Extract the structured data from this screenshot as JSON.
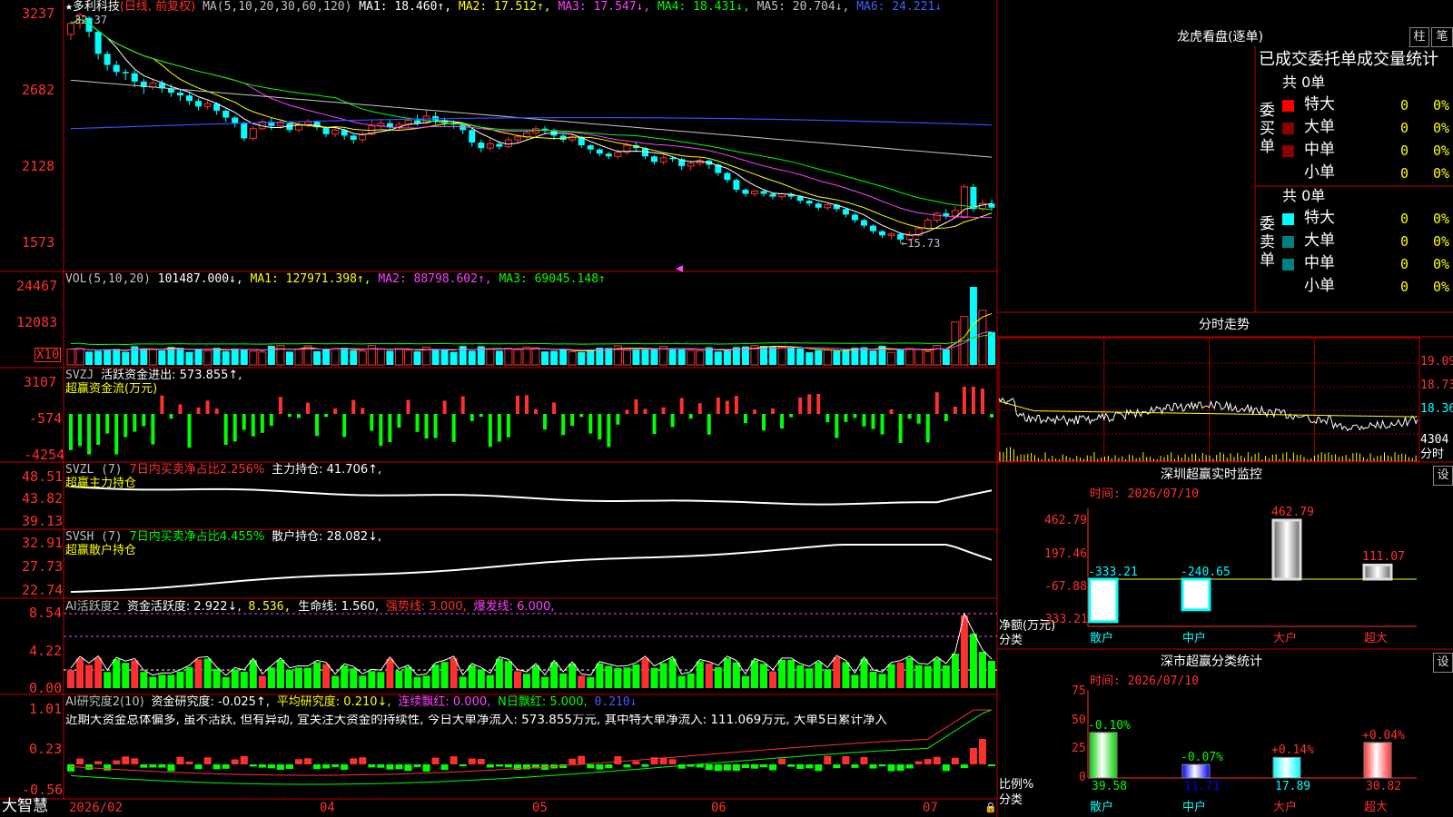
{
  "header": {
    "star": "★",
    "name": "多利科技",
    "mode": "(日线, 前复权)",
    "ma_param": "MA(5,10,20,30,60,120)",
    "ma1": "MA1: 18.460↑,",
    "ma2": "MA2: 17.512↑,",
    "ma3": "MA3: 17.547↓,",
    "ma4": "MA4: 18.431↓,",
    "ma5": "MA5: 20.704↓,",
    "ma6": "MA6: 24.221↓"
  },
  "price_panel": {
    "y_ticks": [
      "3237",
      "2682",
      "2128",
      "1573"
    ],
    "high_label": "32.37",
    "low_label": "←15.73"
  },
  "vol_panel": {
    "title": "VOL(5,10,20)",
    "v": "101487.000↓,",
    "ma1": "MA1: 127971.398↑,",
    "ma2": "MA2: 88798.602↑,",
    "ma3": "MA3: 69045.148↑",
    "y_ticks": [
      "24467",
      "12083"
    ],
    "unit": "X10"
  },
  "svzj_panel": {
    "title": "SVZJ",
    "line": "活跃资金进出: 573.855↑,",
    "sub": "超赢资金流(万元)",
    "y_ticks": [
      "3107",
      "-574",
      "-4254"
    ]
  },
  "svzl_panel": {
    "title": "SVZL (7)",
    "ratio": "7日内买卖净占比2.256%",
    "hold": "主力持仓: 41.706↑,",
    "sub": "超赢主力持仓",
    "y_ticks": [
      "48.51",
      "43.82",
      "39.13"
    ]
  },
  "svsh_panel": {
    "title": "SVSH (7)",
    "ratio": "7日内买卖净占比4.455%",
    "hold": "散户持仓: 28.082↓,",
    "sub": "超赢散户持仓",
    "y_ticks": [
      "32.91",
      "27.73",
      "22.74"
    ]
  },
  "ai1_panel": {
    "title": "AI活跃度2",
    "a": "资金活跃度: 2.922↓,",
    "b": "8.536,",
    "c": "生命线: 1.560,",
    "d": "强势线: 3.000,",
    "e": "爆发线: 6.000,",
    "y_ticks": [
      "8.54",
      "4.22",
      "0.00"
    ]
  },
  "ai2_panel": {
    "title": "AI研究度2(10)",
    "a": "资金研究度: -0.025↑,",
    "b": "平均研究度: 0.210↓,",
    "c": "连续飘红: 0.000,",
    "d": "N日飘红: 5.000,",
    "e": "0.210↓",
    "comment": "近期大资金总体偏多, 虽不活跃, 但有异动, 宜关注大资金的持续性, 今日大单净流入: 573.855万元, 其中特大单净流入: 111.069万元, 大单5日累计净入",
    "y_ticks": [
      "1.01",
      "0.23",
      "-0.56"
    ]
  },
  "bottom_bar": {
    "brand": "大智慧",
    "dates": [
      "2026/02",
      "04",
      "05",
      "06",
      "07"
    ]
  },
  "lhb": {
    "title": "龙虎看盘(逐单)",
    "btn1": "柱",
    "btn2": "笔",
    "subtitle": "已成交委托单成交量统计",
    "buy_label": "委买单",
    "sell_label": "委卖单",
    "buy_total": "共 0单",
    "sell_total": "共 0单",
    "rows": [
      {
        "name": "特大",
        "v": "0",
        "p": "0%"
      },
      {
        "name": "大单",
        "v": "0",
        "p": "0%"
      },
      {
        "name": "中单",
        "v": "0",
        "p": "0%"
      },
      {
        "name": "小单",
        "v": "0",
        "p": "0%"
      }
    ],
    "buy_colors": [
      "#ff0000",
      "#8b0000",
      "#8b0000",
      "#000000"
    ],
    "sell_colors": [
      "#00ffff",
      "#008080",
      "#008080",
      "#000000"
    ]
  },
  "fenshi": {
    "title": "分时走势",
    "prices": [
      "19.09",
      "18.73",
      "18.36"
    ],
    "vol_label": "4304",
    "unit": "分时"
  },
  "sz_monitor": {
    "title": "深圳超赢实时监控",
    "btn": "设",
    "time": "时间: 2026/07/10",
    "y_ticks": [
      "462.79",
      "197.46",
      "-67.88",
      "-333.21"
    ],
    "ylabel1": "净额(万元)",
    "ylabel2": "分类"
  },
  "sz_class": {
    "title": "深市超赢分类统计",
    "btn": "设",
    "time": "时间: 2026/07/10",
    "y_ticks": [
      "75",
      "50",
      "25",
      "0"
    ],
    "ylabel1": "比例%",
    "ylabel2": "分类"
  },
  "chart_data": [
    {
      "type": "bar",
      "title": "深圳超赢实时监控",
      "categories": [
        "散户",
        "中户",
        "大户",
        "超大"
      ],
      "values": [
        -333.21,
        -240.65,
        462.79,
        111.07
      ],
      "value_labels": [
        "-333.21",
        "-240.65",
        "462.79",
        "111.07"
      ],
      "ylim": [
        -333.21,
        462.79
      ]
    },
    {
      "type": "bar",
      "title": "深市超赢分类统计",
      "categories": [
        "散户",
        "中户",
        "大户",
        "超大"
      ],
      "values": [
        39.58,
        11.71,
        17.89,
        30.82
      ],
      "changes": [
        "-0.10%",
        "-0.07%",
        "+0.14%",
        "+0.04%"
      ],
      "ylim": [
        0,
        75
      ]
    },
    {
      "type": "line",
      "title": "price",
      "ylim": [
        15.73,
        32.37
      ],
      "candles": [
        [
          30.8,
          31.6,
          31.8,
          30.4
        ],
        [
          31.6,
          32.2,
          32.37,
          31.2
        ],
        [
          32.0,
          31.0,
          32.1,
          30.6
        ],
        [
          31.0,
          29.4,
          31.1,
          29.0
        ],
        [
          29.4,
          28.6,
          29.6,
          28.2
        ],
        [
          28.6,
          28.1,
          28.9,
          27.8
        ],
        [
          28.1,
          28.0,
          28.3,
          27.5
        ],
        [
          28.0,
          27.4,
          28.2,
          27.0
        ],
        [
          27.4,
          27.0,
          27.6,
          26.5
        ],
        [
          27.0,
          27.3,
          27.6,
          26.8
        ],
        [
          27.3,
          26.9,
          27.5,
          26.6
        ],
        [
          26.9,
          26.6,
          27.2,
          26.3
        ],
        [
          26.6,
          26.4,
          26.8,
          26.0
        ],
        [
          26.4,
          26.0,
          26.6,
          25.7
        ],
        [
          26.0,
          25.6,
          26.2,
          25.3
        ],
        [
          25.6,
          25.8,
          26.0,
          25.4
        ],
        [
          25.8,
          25.3,
          25.9,
          25.0
        ],
        [
          25.3,
          24.8,
          25.4,
          24.5
        ],
        [
          24.8,
          24.4,
          24.9,
          24.1
        ],
        [
          24.4,
          23.3,
          24.5,
          23.1
        ],
        [
          23.3,
          24.0,
          24.2,
          23.1
        ],
        [
          24.0,
          24.5,
          24.7,
          23.9
        ],
        [
          24.5,
          24.2,
          24.8,
          23.9
        ],
        [
          24.2,
          24.4,
          24.6,
          24.0
        ],
        [
          24.4,
          23.9,
          24.5,
          23.7
        ],
        [
          23.9,
          24.3,
          24.5,
          23.7
        ],
        [
          24.3,
          24.5,
          24.7,
          24.1
        ],
        [
          24.5,
          24.1,
          24.6,
          23.9
        ],
        [
          24.1,
          23.6,
          24.2,
          23.4
        ],
        [
          23.6,
          23.9,
          24.1,
          23.4
        ],
        [
          23.9,
          23.5,
          24.0,
          23.2
        ],
        [
          23.5,
          23.2,
          23.6,
          22.9
        ],
        [
          23.2,
          23.6,
          23.8,
          23.0
        ],
        [
          23.6,
          24.2,
          24.6,
          23.5
        ],
        [
          24.2,
          24.4,
          24.7,
          24.0
        ],
        [
          24.4,
          24.1,
          24.6,
          23.8
        ],
        [
          24.1,
          24.3,
          24.5,
          23.9
        ],
        [
          24.3,
          24.6,
          24.8,
          24.1
        ],
        [
          24.6,
          24.4,
          25.0,
          24.2
        ],
        [
          24.4,
          24.9,
          25.4,
          24.3
        ],
        [
          24.9,
          24.6,
          25.2,
          24.3
        ],
        [
          24.6,
          24.4,
          24.8,
          24.1
        ],
        [
          24.4,
          24.3,
          24.6,
          24.0
        ],
        [
          24.3,
          23.9,
          24.4,
          23.6
        ],
        [
          23.9,
          23.0,
          24.0,
          22.7
        ],
        [
          23.0,
          22.6,
          23.2,
          22.3
        ],
        [
          22.6,
          22.9,
          23.3,
          22.4
        ],
        [
          22.9,
          22.7,
          23.1,
          22.5
        ],
        [
          22.7,
          23.2,
          23.4,
          22.6
        ],
        [
          23.2,
          23.4,
          23.6,
          23.0
        ],
        [
          23.4,
          23.7,
          23.9,
          23.2
        ],
        [
          23.7,
          24.0,
          24.2,
          23.5
        ],
        [
          24.0,
          23.9,
          24.2,
          23.6
        ],
        [
          23.9,
          23.5,
          24.0,
          23.2
        ],
        [
          23.5,
          23.2,
          23.6,
          23.0
        ],
        [
          23.2,
          23.4,
          23.6,
          23.0
        ],
        [
          23.4,
          22.8,
          23.5,
          22.6
        ],
        [
          22.8,
          22.5,
          22.9,
          22.2
        ],
        [
          22.5,
          22.2,
          22.6,
          22.0
        ],
        [
          22.2,
          22.0,
          22.3,
          21.8
        ],
        [
          22.0,
          22.3,
          22.5,
          21.8
        ],
        [
          22.3,
          22.8,
          23.0,
          22.1
        ],
        [
          22.8,
          22.6,
          23.0,
          22.3
        ],
        [
          22.6,
          22.0,
          22.7,
          21.8
        ],
        [
          22.0,
          21.6,
          22.1,
          21.4
        ],
        [
          21.6,
          21.9,
          22.1,
          21.4
        ],
        [
          21.9,
          21.8,
          22.0,
          21.6
        ],
        [
          21.8,
          21.3,
          21.9,
          21.0
        ],
        [
          21.3,
          21.5,
          21.7,
          21.0
        ],
        [
          21.5,
          21.7,
          21.9,
          21.3
        ],
        [
          21.7,
          21.4,
          21.8,
          21.1
        ],
        [
          21.4,
          20.8,
          21.5,
          20.6
        ],
        [
          20.8,
          20.3,
          20.9,
          20.1
        ],
        [
          20.3,
          19.6,
          20.4,
          19.4
        ],
        [
          19.6,
          19.3,
          19.7,
          19.1
        ],
        [
          19.3,
          19.5,
          19.6,
          19.1
        ],
        [
          19.5,
          19.3,
          19.6,
          19.1
        ],
        [
          19.3,
          19.1,
          19.4,
          18.9
        ],
        [
          19.1,
          19.3,
          19.4,
          18.9
        ],
        [
          19.3,
          19.1,
          19.4,
          18.9
        ],
        [
          19.1,
          18.8,
          19.2,
          18.6
        ],
        [
          18.8,
          18.6,
          18.9,
          18.4
        ],
        [
          18.6,
          18.3,
          18.7,
          18.1
        ],
        [
          18.3,
          18.5,
          18.6,
          18.1
        ],
        [
          18.5,
          18.2,
          18.6,
          18.0
        ],
        [
          18.2,
          17.8,
          18.3,
          17.6
        ],
        [
          17.8,
          17.4,
          17.9,
          17.2
        ],
        [
          17.4,
          17.0,
          17.5,
          16.8
        ],
        [
          17.0,
          16.6,
          17.1,
          16.4
        ],
        [
          16.6,
          16.3,
          16.7,
          16.1
        ],
        [
          16.3,
          16.4,
          16.5,
          16.0
        ],
        [
          16.4,
          16.0,
          16.5,
          15.73
        ],
        [
          16.0,
          16.3,
          16.6,
          15.9
        ],
        [
          16.3,
          16.8,
          17.0,
          16.2
        ],
        [
          16.8,
          17.4,
          17.6,
          16.7
        ],
        [
          17.4,
          17.9,
          18.0,
          17.2
        ],
        [
          17.9,
          17.7,
          18.2,
          17.5
        ],
        [
          17.7,
          18.1,
          18.4,
          17.6
        ],
        [
          17.6,
          19.8,
          20.0,
          17.5
        ],
        [
          19.8,
          18.2,
          20.0,
          18.0
        ],
        [
          18.2,
          18.6,
          18.9,
          18.0
        ],
        [
          18.6,
          18.3,
          18.9,
          18.1
        ]
      ]
    }
  ]
}
